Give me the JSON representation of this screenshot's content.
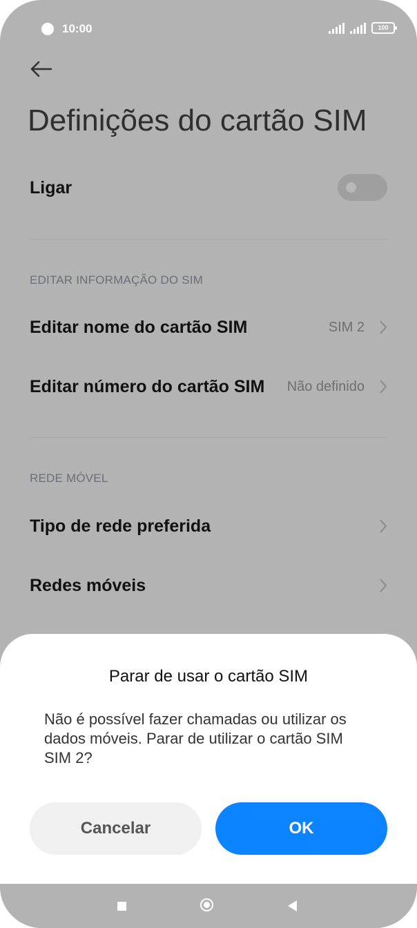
{
  "status_bar": {
    "time": "10:00",
    "battery": "100"
  },
  "page": {
    "title": "Definições do cartão SIM"
  },
  "power_row": {
    "label": "Ligar",
    "enabled": false
  },
  "sections": {
    "edit_info": {
      "header": "EDITAR INFORMAÇÃO DO SIM"
    },
    "mobile_network": {
      "header": "REDE MÓVEL"
    }
  },
  "rows": {
    "edit_name": {
      "label": "Editar nome do cartão SIM",
      "value": "SIM 2"
    },
    "edit_number": {
      "label": "Editar número do cartão SIM",
      "value": "Não definido"
    },
    "network_type": {
      "label": "Tipo de rede preferida"
    },
    "mobile_networks": {
      "label": "Redes móveis"
    }
  },
  "dialog": {
    "title": "Parar de usar o cartão SIM",
    "message": "Não é possível fazer chamadas ou utilizar os dados móveis. Parar de utilizar o cartão SIM SIM 2?",
    "cancel_label": "Cancelar",
    "ok_label": "OK"
  },
  "colors": {
    "accent": "#0d84ff",
    "overlay": "#b3b3b3",
    "dialog_bg": "#ffffff"
  },
  "icons": {
    "back": "arrow-left-icon",
    "chevron": "chevron-right-icon",
    "nav_recent": "square-icon",
    "nav_home": "circle-icon",
    "nav_back": "triangle-back-icon"
  }
}
